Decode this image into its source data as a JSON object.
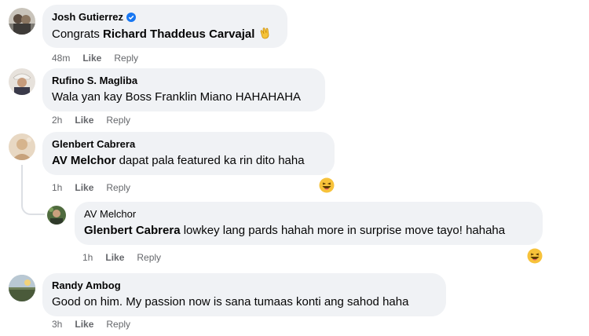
{
  "comments": [
    {
      "author": "Josh Gutierrez",
      "verified": true,
      "text_prefix": "Congrats ",
      "mention": "Richard Thaddeus Carvajal",
      "text_suffix": "",
      "emoji": "clapping-hands",
      "time": "48m",
      "like": "Like",
      "reply": "Reply"
    },
    {
      "author": "Rufino S. Magliba",
      "text": "Wala yan kay Boss Franklin Miano HAHAHAHA",
      "time": "2h",
      "like": "Like",
      "reply": "Reply"
    },
    {
      "author": "Glenbert Cabrera",
      "mention": "AV Melchor",
      "text": " dapat pala featured ka rin dito haha",
      "time": "1h",
      "like": "Like",
      "reply": "Reply",
      "reaction": "haha"
    },
    {
      "author": "AV Melchor",
      "mention": "Glenbert Cabrera",
      "text": " lowkey lang pards hahah more in surprise move tayo! hahaha",
      "time": "1h",
      "like": "Like",
      "reply": "Reply",
      "reaction": "haha"
    },
    {
      "author": "Randy Ambog",
      "text": "Good on him. My passion now is sana tumaas konti ang sahod haha",
      "time": "3h",
      "like": "Like",
      "reply": "Reply"
    }
  ],
  "colors": {
    "bubble": "#f0f2f5",
    "meta": "#65676b",
    "verified": "#1877f2"
  }
}
